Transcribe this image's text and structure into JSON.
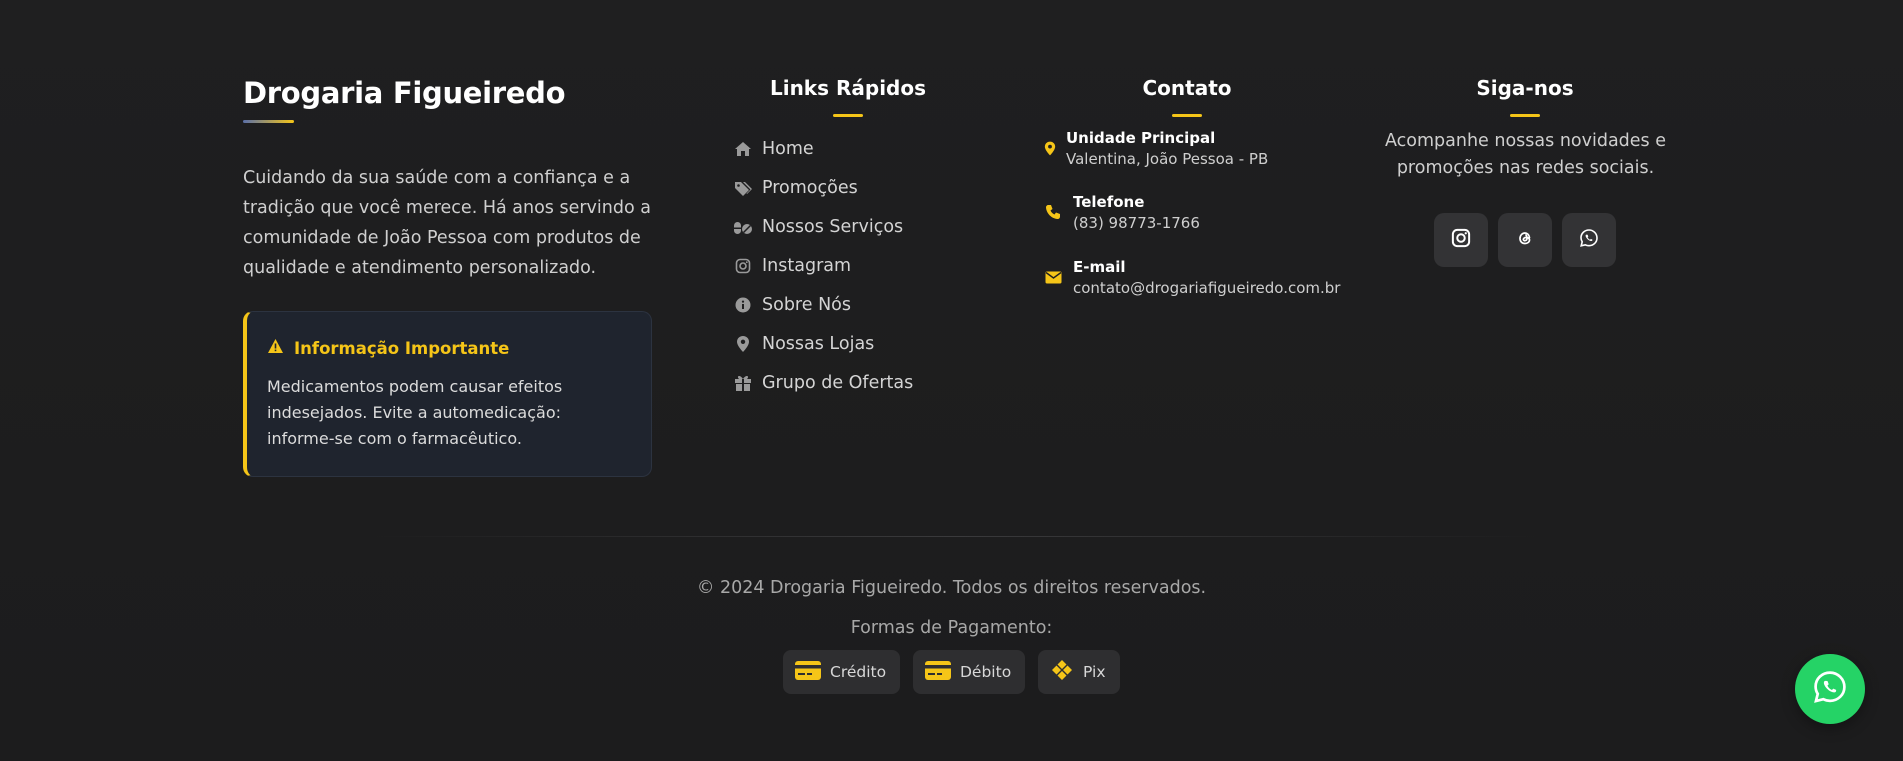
{
  "brand": {
    "title": "Drogaria Figueiredo",
    "description": "Cuidando da sua saúde com a confiança e a tradição que você merece. Há anos servindo a comunidade de João Pessoa com produtos de qualidade e atendimento personalizado."
  },
  "notice": {
    "title": "Informação Importante",
    "text": "Medicamentos podem causar efeitos indesejados. Evite a automedicação: informe-se com o farmacêutico."
  },
  "quick_links": {
    "title": "Links Rápidos",
    "items": [
      {
        "label": "Home",
        "icon": "home-icon"
      },
      {
        "label": "Promoções",
        "icon": "tags-icon"
      },
      {
        "label": "Nossos Serviços",
        "icon": "pills-icon"
      },
      {
        "label": "Instagram",
        "icon": "instagram-icon"
      },
      {
        "label": "Sobre Nós",
        "icon": "info-icon"
      },
      {
        "label": "Nossas Lojas",
        "icon": "map-pin-icon"
      },
      {
        "label": "Grupo de Ofertas",
        "icon": "gift-icon"
      }
    ]
  },
  "contact": {
    "title": "Contato",
    "address_label": "Unidade Principal",
    "address_value": "Valentina, João Pessoa - PB",
    "phone_label": "Telefone",
    "phone_value": "(83) 98773-1766",
    "email_label": "E-mail",
    "email_value": "contato@drogariafigueiredo.com.br"
  },
  "follow": {
    "title": "Siga-nos",
    "text": "Acompanhe nossas novidades e promoções nas redes sociais.",
    "networks": [
      "instagram-icon",
      "threads-icon",
      "whatsapp-icon"
    ]
  },
  "bottom": {
    "copyright": "© 2024 Drogaria Figueiredo. Todos os direitos reservados.",
    "payment_title": "Formas de Pagamento:",
    "payments": [
      {
        "label": "Crédito",
        "icon": "credit-card-icon"
      },
      {
        "label": "Débito",
        "icon": "debit-card-icon"
      },
      {
        "label": "Pix",
        "icon": "pix-icon"
      }
    ]
  },
  "colors": {
    "accent": "#f5c518",
    "background": "#1f1f20",
    "whatsapp": "#25d366"
  }
}
